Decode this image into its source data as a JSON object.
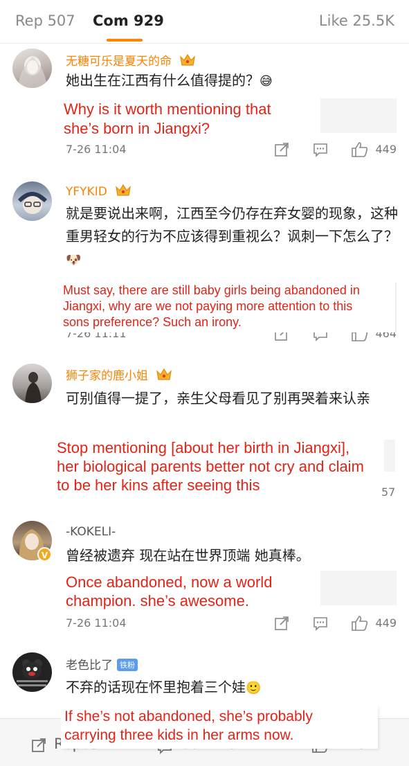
{
  "tabs": [
    {
      "label": "Rep 507"
    },
    {
      "label": "Com 929"
    },
    {
      "label": "Like 25.5K"
    }
  ],
  "colors": {
    "accent": "#ff8200",
    "translation": "#e22418",
    "fan_badge": "#5b9cf0"
  },
  "comments": [
    {
      "username": "无糖可乐是夏天的命",
      "text": "她出生在江西有什么值得提的？",
      "emoji": "😅",
      "translation": [
        "Why is it worth mentioning that",
        "she’s born in Jiangxi?"
      ],
      "time": "7-26 11:04",
      "likes": "449"
    },
    {
      "username": "YFYKID",
      "text": "就是要说出来啊，江西至今仍存在弃女婴的现象，这种重男轻女的行为不应该得到重视么？讽刺一下怎么了？",
      "emoji": "🐶",
      "translation": [
        "Must say, there are still baby girls being abandoned in",
        "Jiangxi, why are we not paying more attention to this",
        "sons preference? Such an irony."
      ],
      "time": "7-26 11:11",
      "likes": "464"
    },
    {
      "username": "狮子家的鹿小姐",
      "text": "可别值得一提了，亲生父母看见了别再哭着来认亲",
      "translation": [
        "Stop mentioning [about her birth in Jiangxi],",
        "her biological parents better not cry and claim",
        "to be her kins after seeing this"
      ],
      "likes_partial": "57"
    },
    {
      "username": "-KOKELI-",
      "text": "曾经被遗弃 现在站在世界顶端 她真棒。",
      "translation": [
        "Once abandoned, now a world",
        "champion. she’s awesome."
      ],
      "time": "7-26 11:04",
      "likes": "449"
    },
    {
      "username": "老色比了",
      "fan_badge": "铁粉",
      "text": "不弃的话现在怀里抱着三个娃",
      "emoji": "🙂",
      "translation": [
        "If she’s not abandoned, she’s probably",
        "carrying three kids in her arms now."
      ]
    }
  ],
  "bottom_bar": {
    "repost": "Repost",
    "comment": "Comment",
    "like": "Like"
  }
}
